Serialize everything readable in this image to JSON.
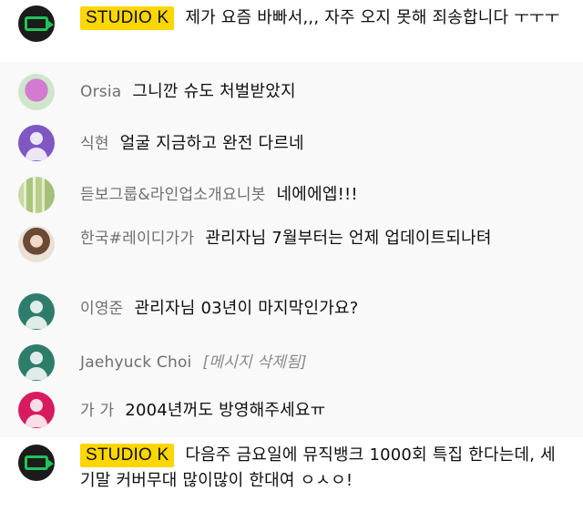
{
  "messages": [
    {
      "author": "STUDIO K",
      "text": "제가 요즘 바빠서,,, 자주 오지 못해 죄송합니다 ㅜㅜㅜ",
      "avatar": "studio-k-logo"
    },
    {
      "author": "Orsia",
      "text": "그니깐 슈도 처벌받았지",
      "avatar": "photo-pink"
    },
    {
      "author": "식현",
      "text": "얼굴 지금하고 완전 다르네",
      "avatar": "default-purple",
      "color": "#7e57c2"
    },
    {
      "author": "듣보그룹&라인업소개요니봇",
      "text": "네에에엡!!!",
      "avatar": "photo-forest"
    },
    {
      "author": "한국#레이디가가",
      "text": "관리자님 7월부터는 언제 업데이트되나텨",
      "avatar": "photo-girl"
    },
    {
      "author": "이영준",
      "text": "관리자님 03년이 마지막인가요?",
      "avatar": "default-teal",
      "color": "#2e7d6b"
    },
    {
      "author": "Jaehyuck Choi",
      "text": "[메시지 삭제됨]",
      "avatar": "default-teal",
      "color": "#2e7d6b"
    },
    {
      "author": "가 가",
      "text": "2004년꺼도 방영해주세요ㅠ",
      "avatar": "default-pink",
      "color": "#d81b60"
    },
    {
      "author": "STUDIO K",
      "text": "다음주 금요일에 뮤직뱅크 1000회 특집 한다는데, 세기말 커버무대 많이많이 한대여 ㅇㅅㅇ!",
      "avatar": "studio-k-logo"
    }
  ],
  "colors": {
    "owner_badge": "#ffd600",
    "author": "#6f6f6f",
    "logo_green": "#20c45a"
  }
}
